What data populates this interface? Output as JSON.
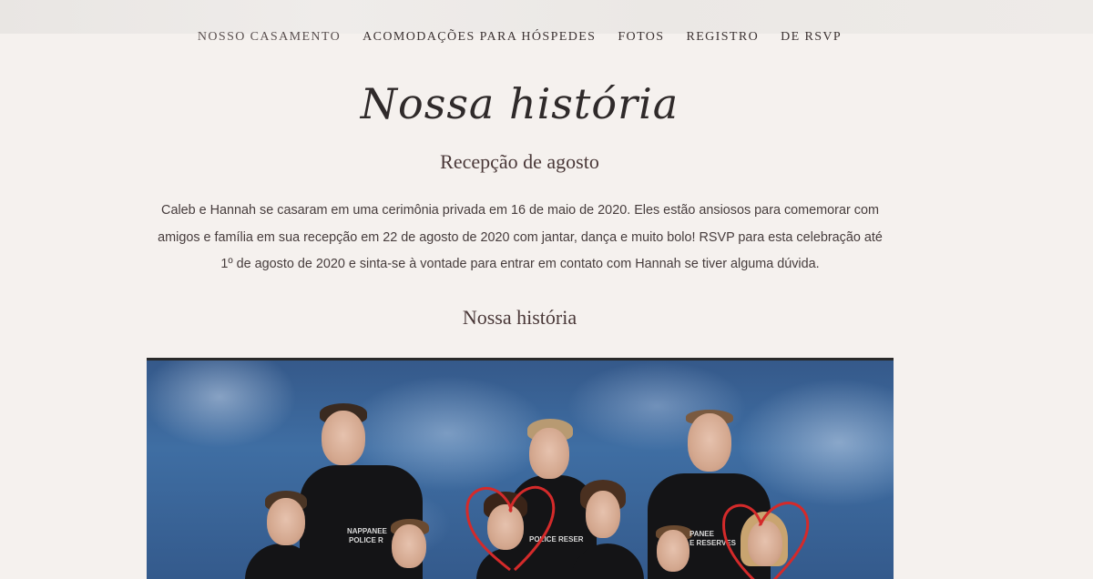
{
  "nav": {
    "items": [
      {
        "label": "NOSSO CASAMENTO"
      },
      {
        "label": "ACOMODAÇÕES PARA HÓSPEDES"
      },
      {
        "label": "FOTOS"
      },
      {
        "label": "REGISTRO"
      },
      {
        "label": "DE RSVP"
      }
    ]
  },
  "hero": {
    "script_title": "Nossa história"
  },
  "section1": {
    "title": "Recepção de agosto",
    "body": "Caleb e Hannah se casaram em uma cerimônia privada em 16 de maio de 2020. Eles estão ansiosos para comemorar com amigos e família em sua recepção em 22 de agosto de 2020 com jantar, dança e muito bolo! RSVP para esta celebração até 1º de agosto de 2020 e sinta-se à vontade para entrar em contato com Hannah se tiver alguma dúvida."
  },
  "section2": {
    "title": "Nossa história"
  },
  "photo": {
    "shirt_texts": [
      "NAPPANEE",
      "POLICE R",
      "POLICE RESER",
      "PANEE",
      "E RESERVES"
    ]
  },
  "colors": {
    "background": "#f5f1ee",
    "text": "#3b2f2f",
    "heart": "#d42a2a"
  }
}
